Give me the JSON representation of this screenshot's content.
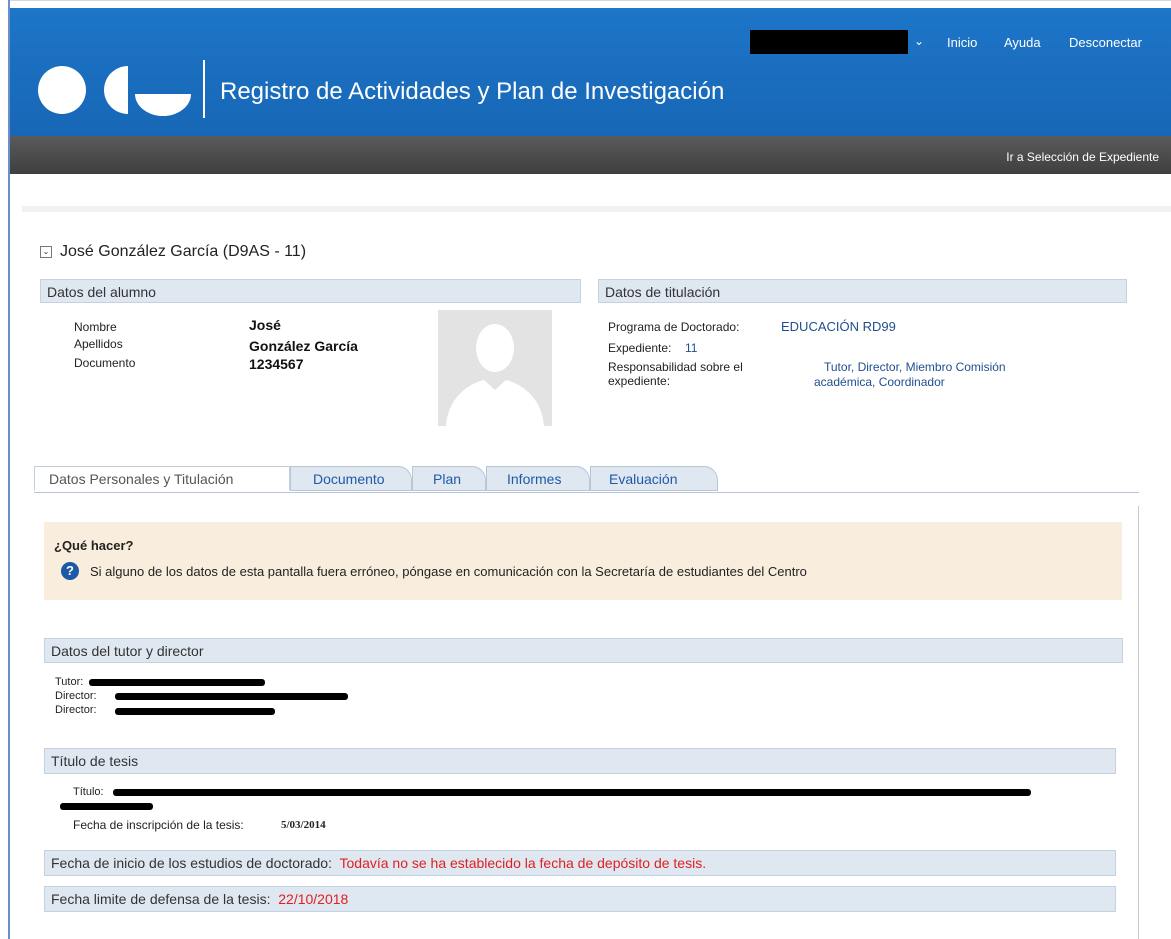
{
  "header": {
    "app_title": "Registro de Actividades y Plan de Investigación",
    "links": {
      "inicio": "Inicio",
      "ayuda": "Ayuda",
      "desconectar": "Desconectar"
    },
    "secondary_link": "Ir a Selección de Expediente"
  },
  "student": {
    "heading": "José González García (D9AS - 11)"
  },
  "alumno": {
    "section_title": "Datos del alumno",
    "labels": {
      "nombre": "Nombre",
      "apellidos": "Apellidos",
      "documento": "Documento"
    },
    "values": {
      "nombre": "José",
      "apellidos": "González García",
      "documento": "1234567"
    }
  },
  "titulacion": {
    "section_title": "Datos de titulación",
    "programa_label": "Programa de Doctorado:",
    "programa_value": "EDUCACIÓN RD99",
    "expediente_label": "Expediente:",
    "expediente_value": "11",
    "responsabilidad_label_1": "Responsabilidad sobre el",
    "responsabilidad_label_2": "expediente:",
    "responsabilidad_value_1": "Tutor, Director, Miembro Comisión",
    "responsabilidad_value_2": "académica, Coordinador"
  },
  "tabs": [
    {
      "label": "Datos Personales y Titulación"
    },
    {
      "label": "Documento"
    },
    {
      "label": "Plan"
    },
    {
      "label": "Informes"
    },
    {
      "label": "Evaluación"
    }
  ],
  "que_hacer": {
    "title": "¿Qué hacer?",
    "text": "Si alguno de los datos de esta pantalla fuera erróneo, póngase en comunicación con la Secretaría de estudiantes del Centro"
  },
  "tutor_director": {
    "section_title": "Datos del tutor y director",
    "tutor_label": "Tutor:",
    "director_label": "Director:",
    "director2_label": "Director:"
  },
  "tesis": {
    "section_title": "Título de tesis",
    "titulo_label": "Título:",
    "fecha_label": "Fecha de inscripción de la tesis:",
    "fecha_value": "5/03/2014"
  },
  "inicio_estudios": {
    "label": "Fecha de inicio de los estudios de doctorado:",
    "value": "Todavía no se ha establecido la fecha de depósito de tesis."
  },
  "limite_defensa": {
    "label": "Fecha limite de defensa de la tesis:",
    "value": "22/10/2018"
  },
  "colors": {
    "header_blue": "#1b6fc0",
    "dark_bar": "#4a4a4a",
    "section_bg": "#dfe7f1",
    "info_bg": "#f9eedd",
    "red": "#e02020"
  },
  "icons": [
    "logo",
    "chevron-down-icon",
    "collapse-icon",
    "help-icon",
    "avatar"
  ]
}
